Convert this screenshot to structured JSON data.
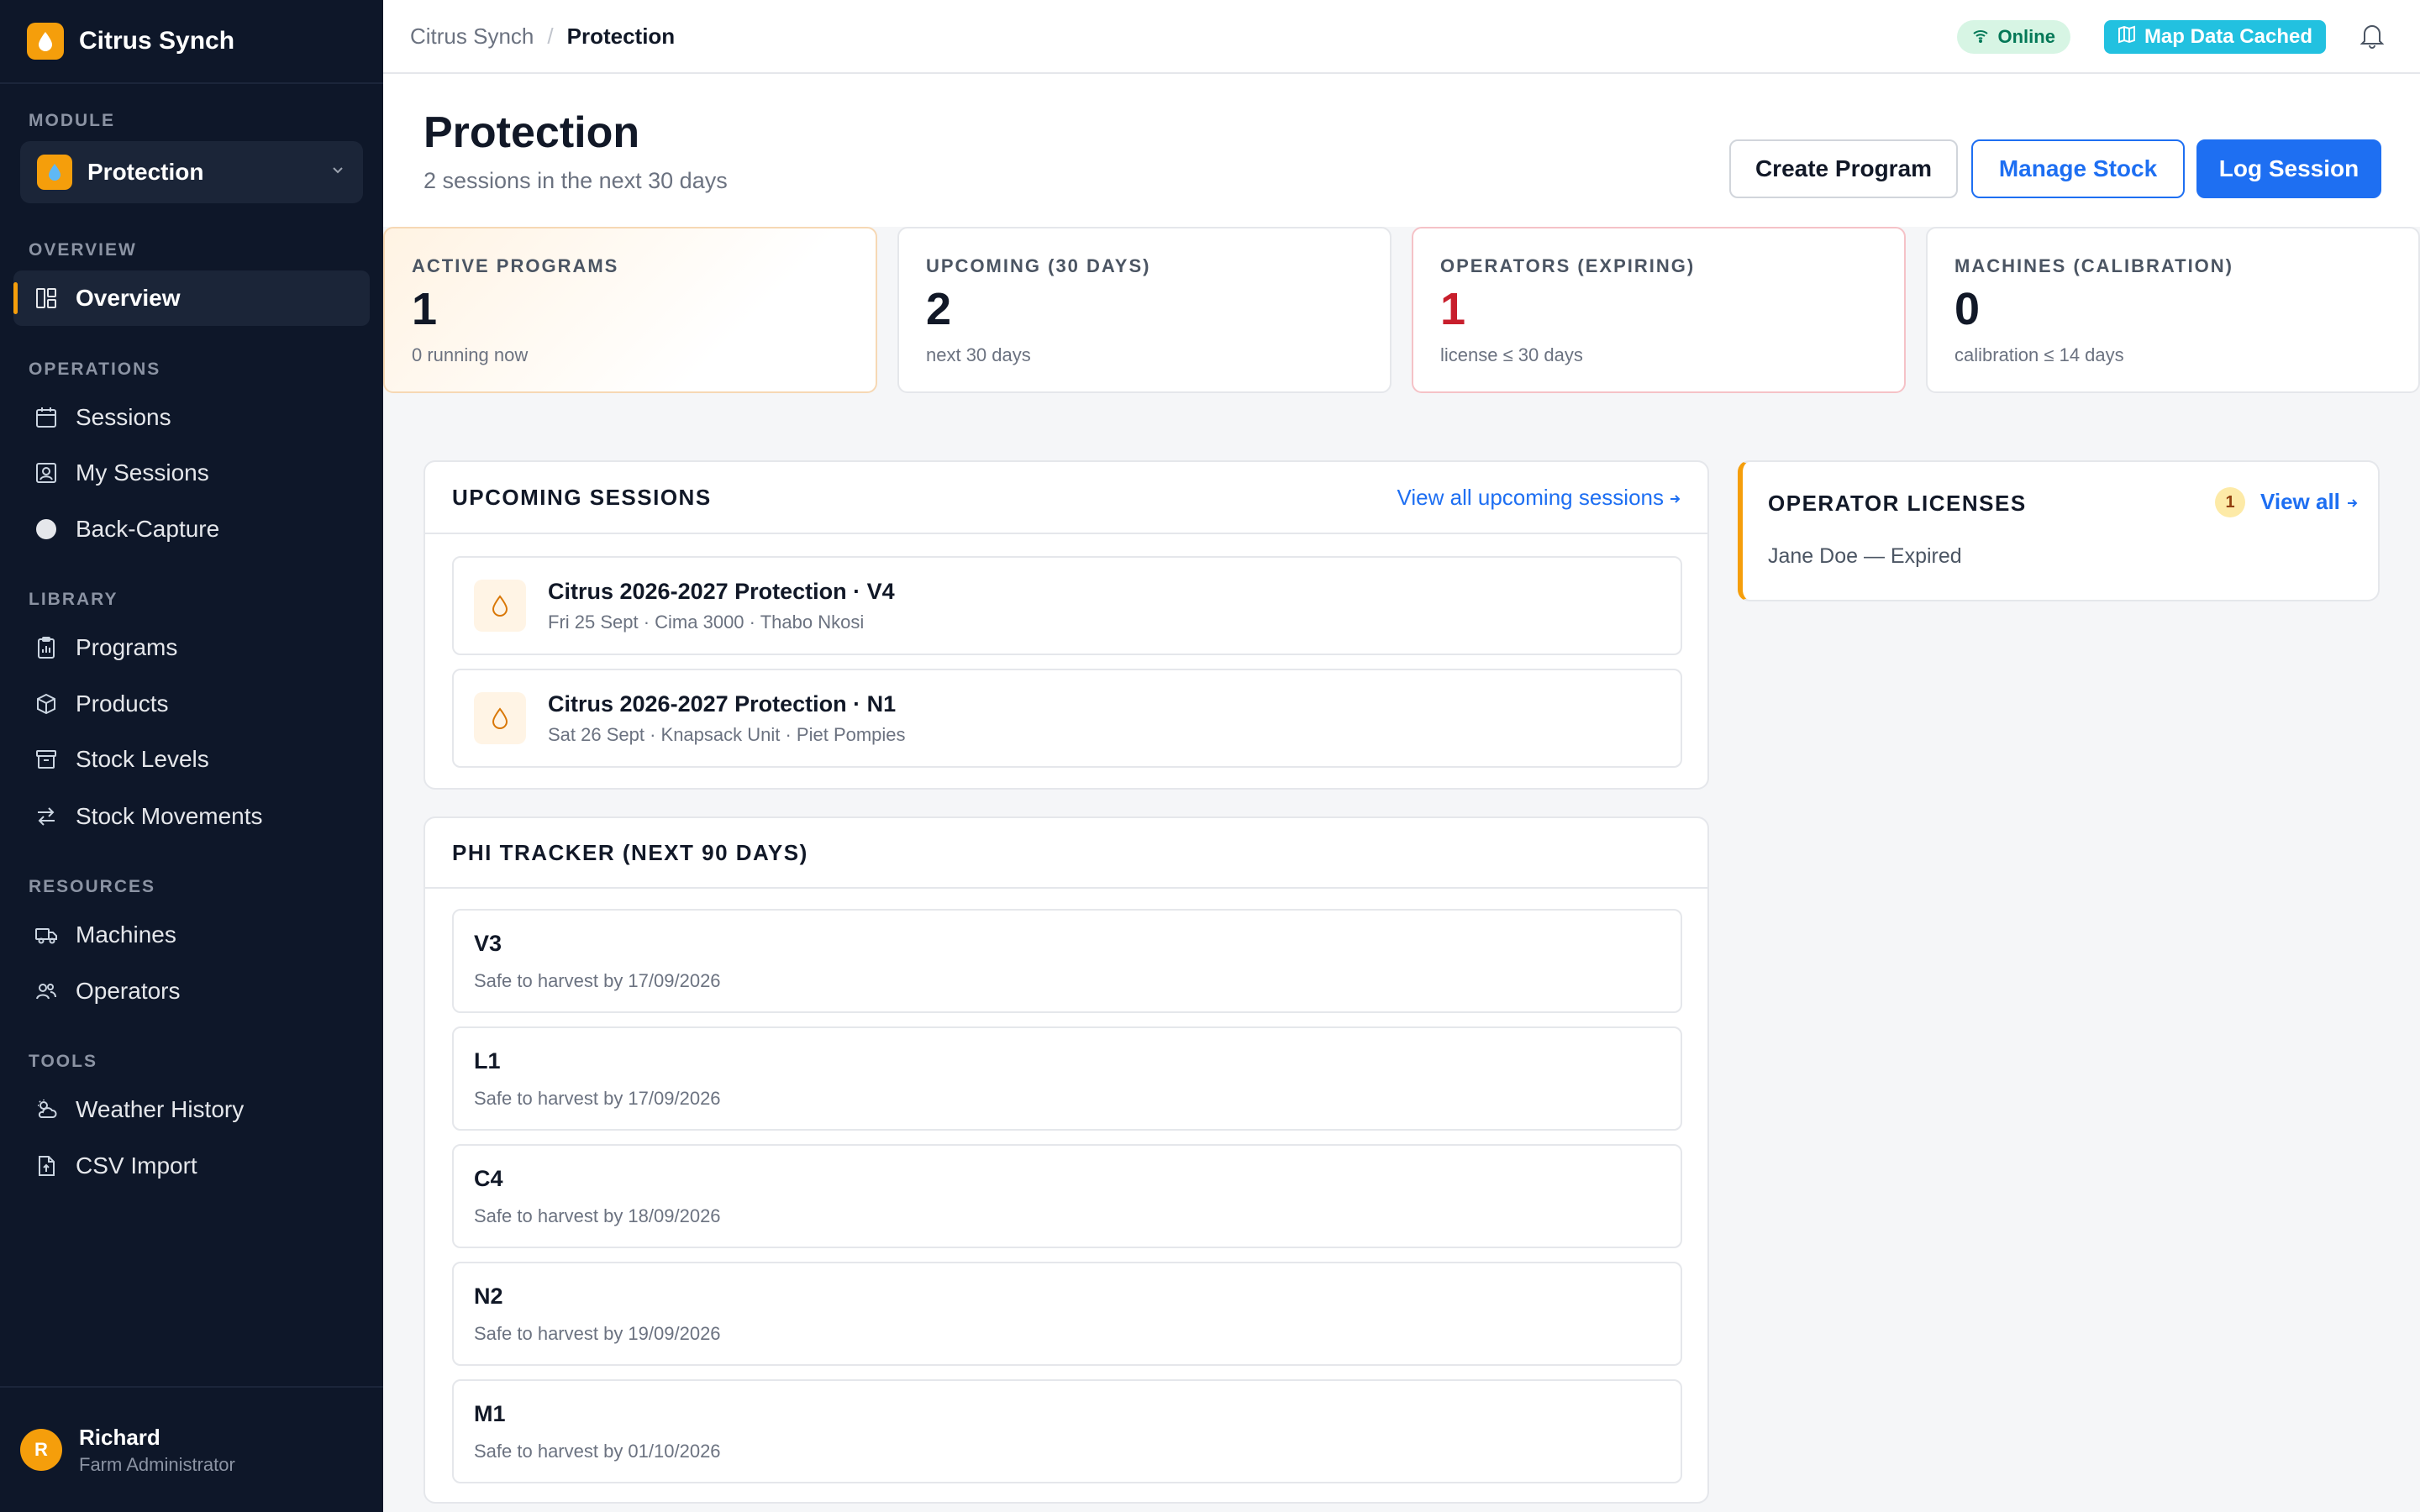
{
  "app": {
    "name": "Citrus Synch"
  },
  "sidebar": {
    "module_label": "MODULE",
    "module_value": "Protection",
    "sections": {
      "overview": "OVERVIEW",
      "operations": "OPERATIONS",
      "library": "LIBRARY",
      "resources": "RESOURCES",
      "tools": "TOOLS"
    },
    "items": {
      "overview": "Overview",
      "sessions": "Sessions",
      "my_sessions": "My Sessions",
      "back_capture": "Back-Capture",
      "programs": "Programs",
      "products": "Products",
      "stock_levels": "Stock Levels",
      "stock_movements": "Stock Movements",
      "machines": "Machines",
      "operators": "Operators",
      "weather_history": "Weather History",
      "csv_import": "CSV Import"
    },
    "active_item": "overview",
    "user": {
      "initial": "R",
      "name": "Richard",
      "role": "Farm Administrator"
    }
  },
  "topbar": {
    "breadcrumb_root": "Citrus Synch",
    "breadcrumb_separator": "/",
    "breadcrumb_current": "Protection",
    "status_online": "Online",
    "map_cached": "Map Data Cached"
  },
  "header": {
    "title": "Protection",
    "subtitle": "2 sessions in the next 30 days",
    "buttons": {
      "create_program": "Create Program",
      "manage_stock": "Manage Stock",
      "log_session": "Log Session"
    }
  },
  "stats": [
    {
      "label": "ACTIVE PROGRAMS",
      "value": "1",
      "note": "0 running now"
    },
    {
      "label": "UPCOMING (30 DAYS)",
      "value": "2",
      "note": "next 30 days"
    },
    {
      "label": "OPERATORS (EXPIRING)",
      "value": "1",
      "note": "license ≤ 30 days"
    },
    {
      "label": "MACHINES (CALIBRATION)",
      "value": "0",
      "note": "calibration ≤ 14 days"
    }
  ],
  "upcoming": {
    "title": "UPCOMING SESSIONS",
    "link": "View all upcoming sessions",
    "sessions": [
      {
        "title": "Citrus 2026-2027 Protection · V4",
        "meta": "Fri 25 Sept · Cima 3000 · Thabo Nkosi"
      },
      {
        "title": "Citrus 2026-2027 Protection · N1",
        "meta": "Sat 26 Sept · Knapsack Unit · Piet Pompies"
      }
    ]
  },
  "phi": {
    "title": "PHI TRACKER (NEXT 90 DAYS)",
    "rows": [
      {
        "code": "V3",
        "note": "Safe to harvest by 17/09/2026"
      },
      {
        "code": "L1",
        "note": "Safe to harvest by 17/09/2026"
      },
      {
        "code": "C4",
        "note": "Safe to harvest by 18/09/2026"
      },
      {
        "code": "N2",
        "note": "Safe to harvest by 19/09/2026"
      },
      {
        "code": "M1",
        "note": "Safe to harvest by 01/10/2026"
      }
    ]
  },
  "licenses": {
    "title": "OPERATOR LICENSES",
    "count": "1",
    "link": "View all",
    "items": [
      "Jane Doe — Expired"
    ]
  },
  "colors": {
    "sidebar_bg": "#0e1729",
    "accent_orange": "#f59e0b",
    "primary_blue": "#1e6ff2",
    "alert_red": "#c81e2c",
    "online_green": "#047857",
    "cached_cyan": "#22c1e0"
  }
}
